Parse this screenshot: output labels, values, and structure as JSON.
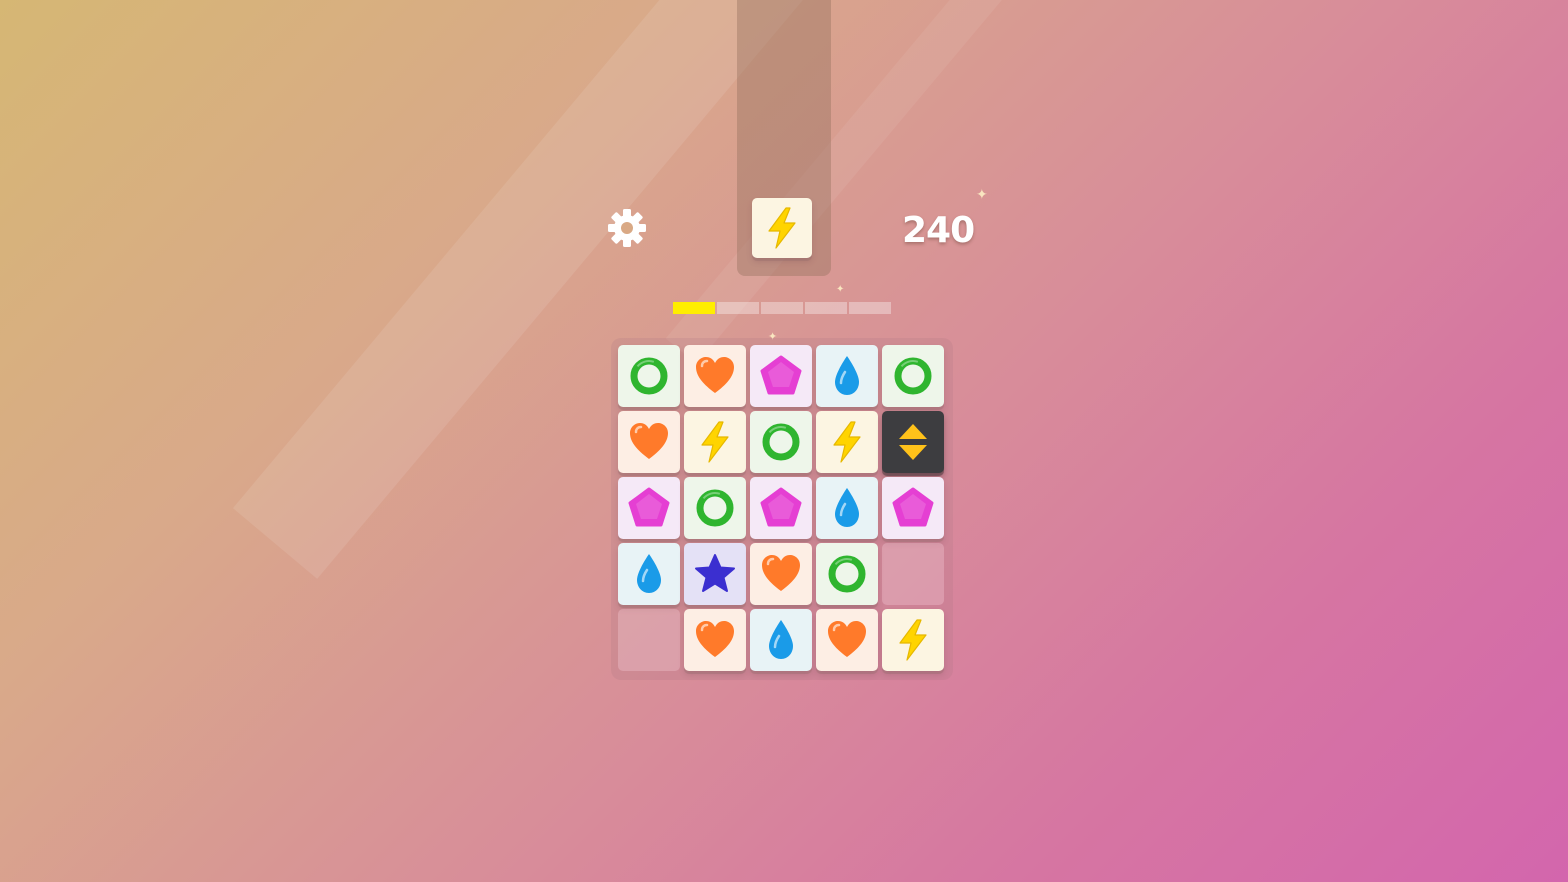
{
  "hud": {
    "settings_icon": "gear-icon",
    "next_piece": "lightning",
    "score": "240"
  },
  "progress": {
    "segments": 5,
    "filled": 1
  },
  "board": {
    "rows": 5,
    "cols": 5,
    "cells": [
      [
        "ring",
        "heart",
        "pentagon",
        "drop",
        "ring"
      ],
      [
        "heart",
        "lightning",
        "ring",
        "lightning",
        "swap"
      ],
      [
        "pentagon",
        "ring",
        "pentagon",
        "drop",
        "pentagon"
      ],
      [
        "drop",
        "star",
        "heart",
        "ring",
        "empty"
      ],
      [
        "empty",
        "heart",
        "drop",
        "heart",
        "lightning"
      ]
    ]
  },
  "colors": {
    "ring": "#2fb52f",
    "heart": "#ff7a2a",
    "pentagon": "#e53fd3",
    "drop": "#1a9be8",
    "lightning": "#ffd400",
    "star": "#3b2fd0",
    "swap_arrows": "#ffc21a",
    "progress_fill": "#ffee00"
  }
}
